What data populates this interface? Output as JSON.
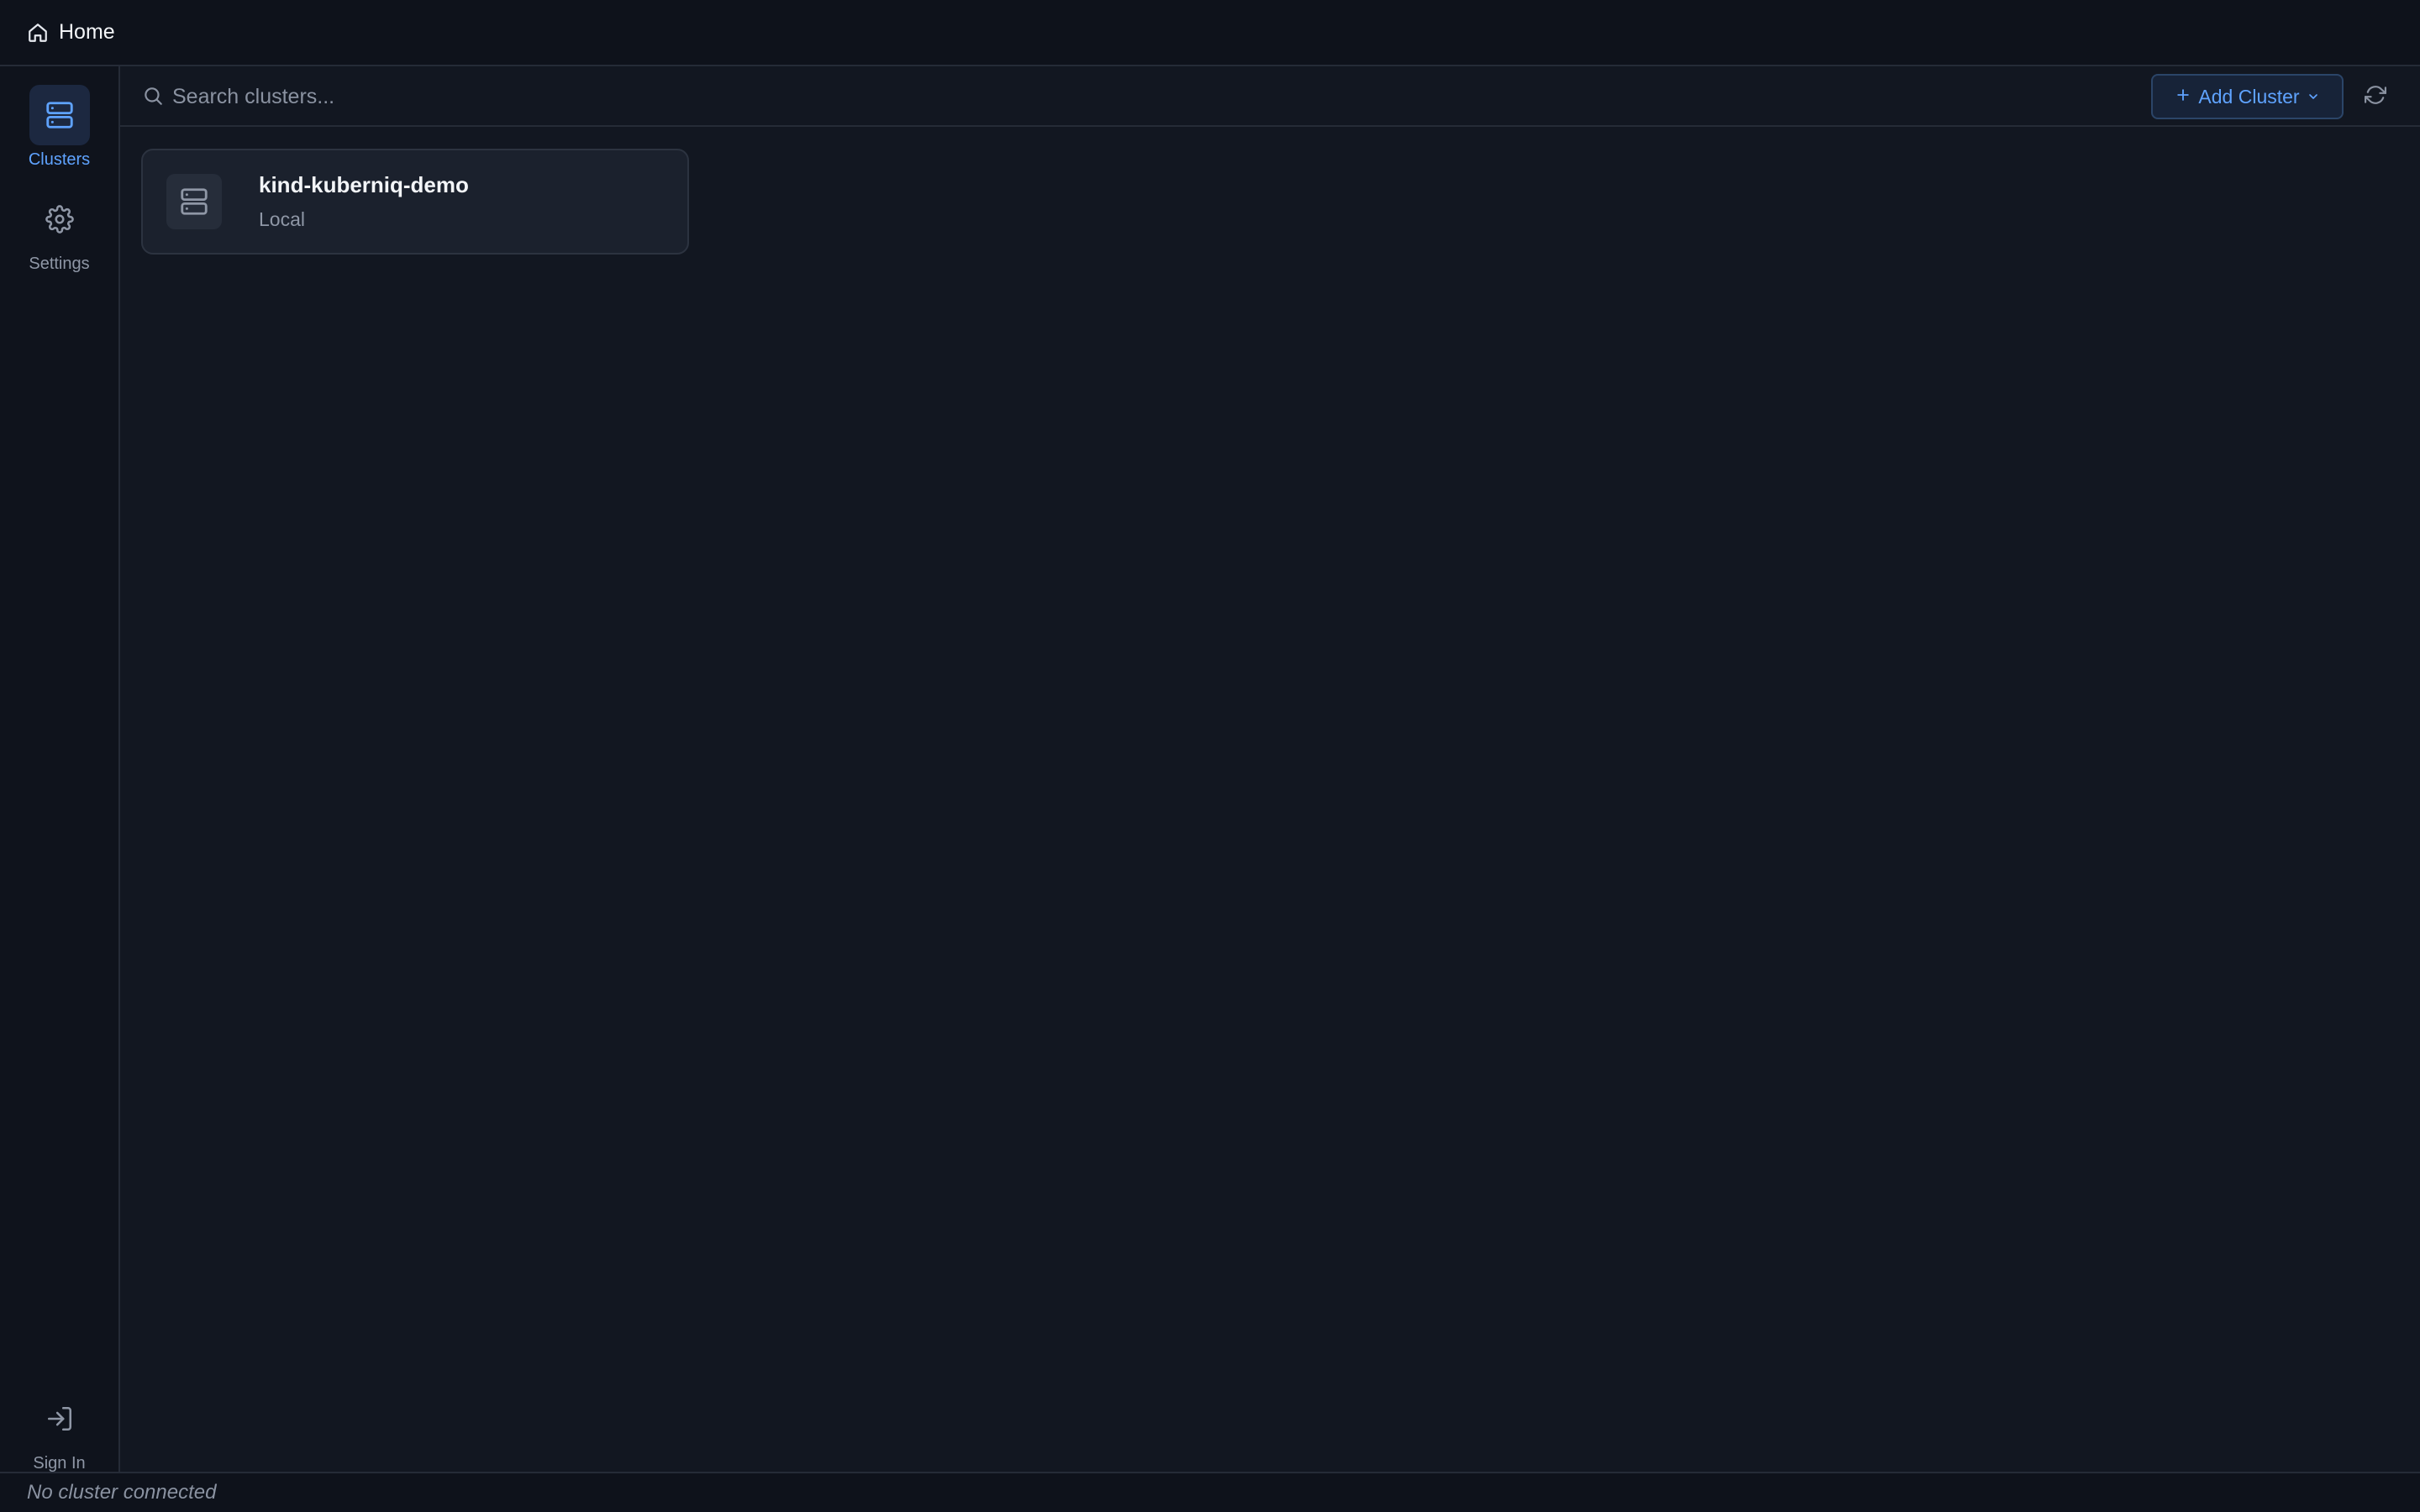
{
  "header": {
    "home_label": "Home",
    "home_icon": "home-icon"
  },
  "sidebar": {
    "items": [
      {
        "label": "Clusters",
        "icon": "server-icon",
        "active": true
      },
      {
        "label": "Settings",
        "icon": "gear-icon",
        "active": false
      }
    ],
    "footer_item": {
      "label": "Sign In",
      "icon": "sign-in-icon"
    }
  },
  "toolbar": {
    "search_placeholder": "Search clusters...",
    "search_value": "",
    "add_cluster_label": "Add Cluster",
    "add_icon": "plus-icon",
    "dropdown_icon": "chevron-down-icon",
    "refresh_icon": "refresh-icon"
  },
  "clusters": [
    {
      "name": "kind-kuberniq-demo",
      "type": "Local",
      "icon": "server-icon"
    }
  ],
  "status": {
    "text": "No cluster connected"
  },
  "colors": {
    "accent": "#5fa3ff",
    "background": "#121721",
    "sidebar_background": "#0f131c",
    "card_background": "#1b212d"
  }
}
